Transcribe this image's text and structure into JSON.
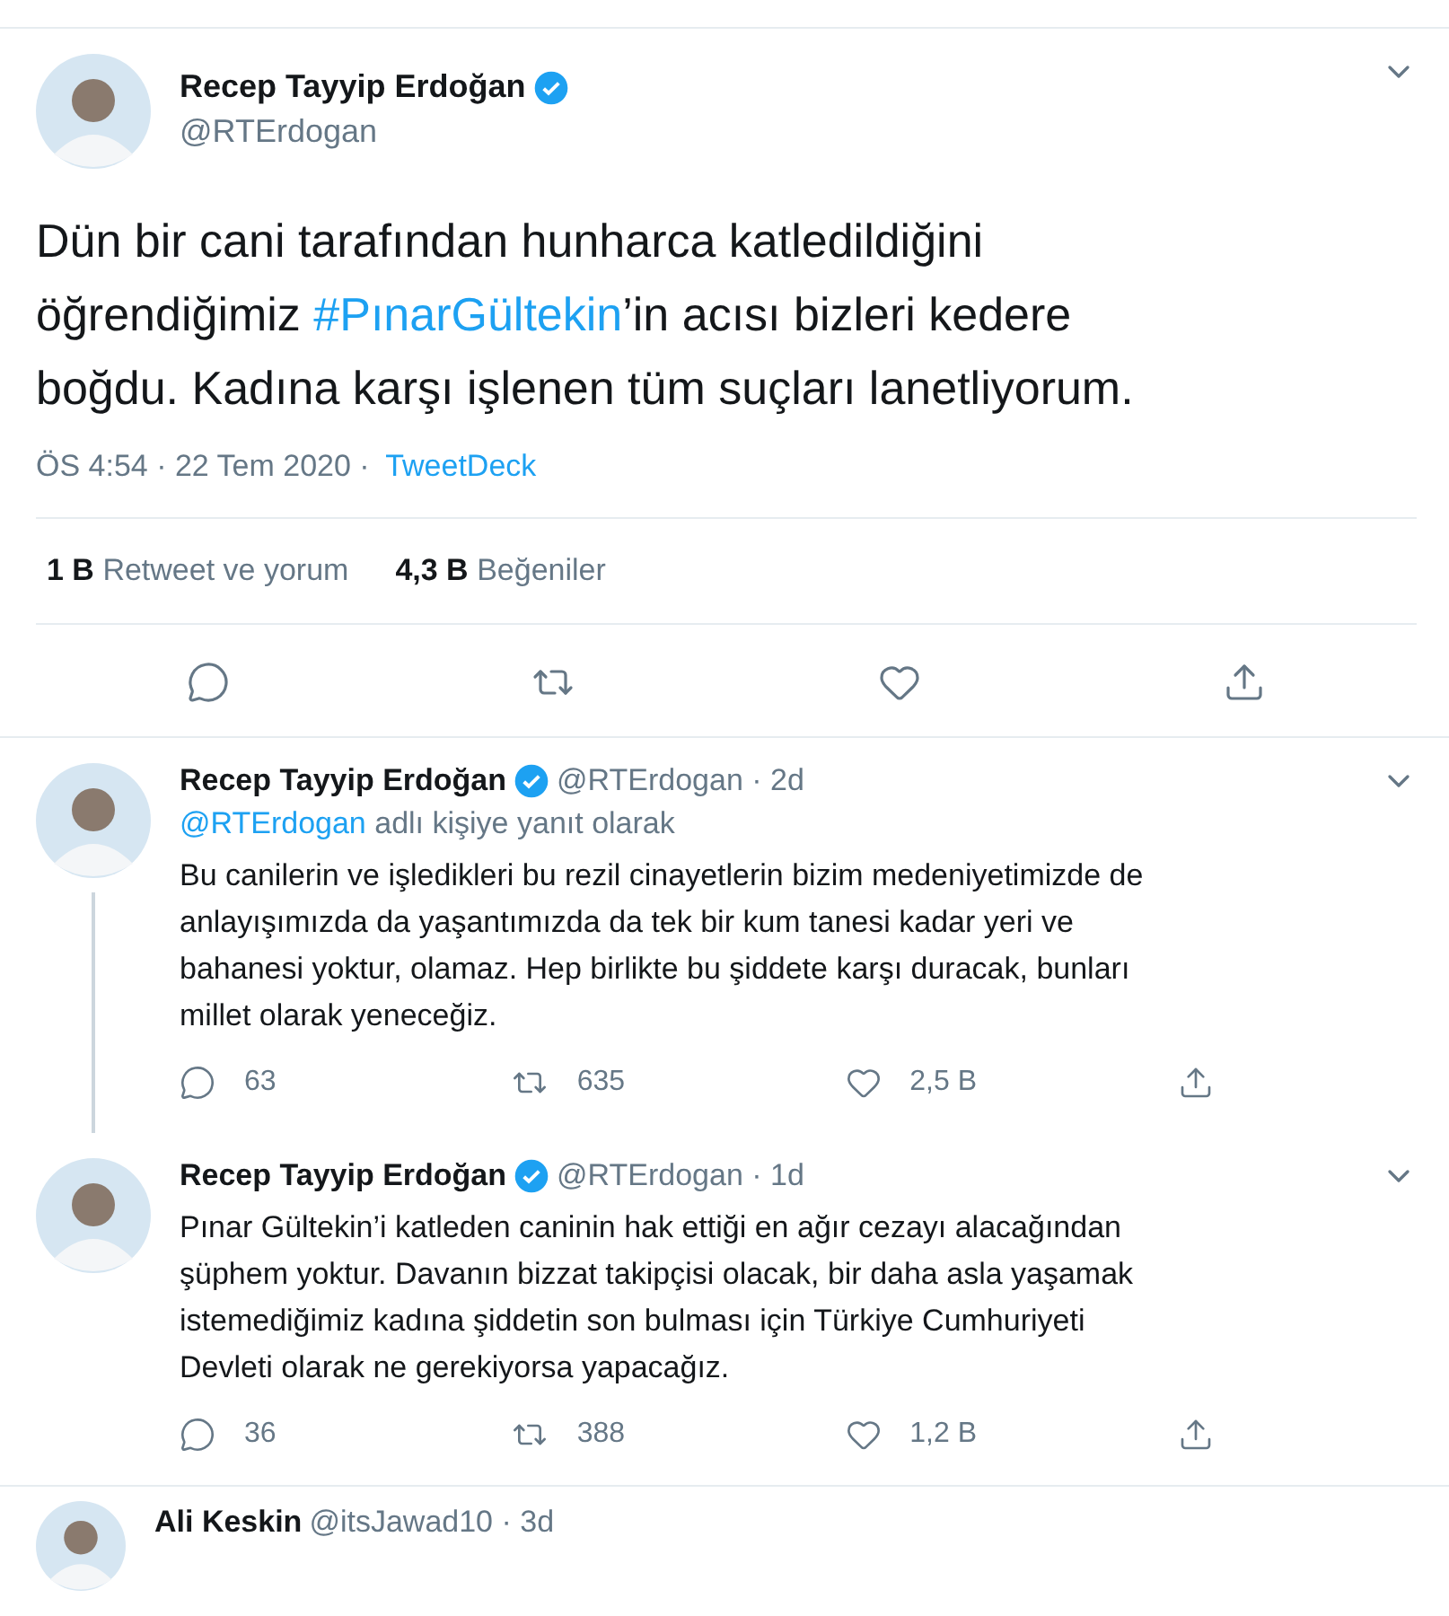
{
  "main_tweet": {
    "author": {
      "name": "Recep Tayyip Erdoğan",
      "handle": "@RTErdogan",
      "verified": true
    },
    "text": [
      {
        "kind": "plain",
        "text": "Dün bir cani tarafından hunharca katledildiğini öğrendiğimiz "
      },
      {
        "kind": "hashtag",
        "text": "#PınarGültekin"
      },
      {
        "kind": "plain",
        "text": "’in acısı bizleri kedere boğdu. Kadına karşı işlenen tüm suçları lanetliyorum."
      }
    ],
    "meta": {
      "time": "ÖS 4:54 · 22 Tem 2020 · ",
      "source": "TweetDeck"
    },
    "stats": [
      {
        "count": "1 B",
        "label": "Retweet ve yorum"
      },
      {
        "count": "4,3 B",
        "label": "Beğeniler"
      }
    ],
    "actions": [
      {
        "kind": "reply"
      },
      {
        "kind": "retweet"
      },
      {
        "kind": "like"
      },
      {
        "kind": "share"
      }
    ]
  },
  "replies": [
    {
      "name": "Recep Tayyip Erdoğan",
      "verified": true,
      "handle_time": "@RTErdogan · 2d",
      "reply_to": {
        "mention": "@RTErdogan",
        "text": "adlı kişiye yanıt olarak"
      },
      "thread_line": true,
      "text": "Bu canilerin ve işledikleri bu rezil cinayetlerin bizim medeniyetimizde de anlayışımızda da yaşantımızda da tek bir kum tanesi kadar yeri ve bahanesi yoktur, olamaz. Hep birlikte bu şiddete karşı duracak, bunları millet olarak yeneceğiz.",
      "actions": [
        {
          "kind": "reply",
          "count": "63"
        },
        {
          "kind": "retweet",
          "count": "635"
        },
        {
          "kind": "like",
          "count": "2,5 B"
        },
        {
          "kind": "share"
        }
      ]
    },
    {
      "name": "Recep Tayyip Erdoğan",
      "verified": true,
      "handle_time": "@RTErdogan · 1d",
      "text": "Pınar Gültekin’i katleden caninin hak ettiği en ağır cezayı alacağından şüphem yoktur. Davanın bizzat takipçisi olacak, bir daha asla yaşamak istemediğimiz kadına şiddetin son bulması için Türkiye Cumhuriyeti Devleti olarak ne gerekiyorsa yapacağız.",
      "actions": [
        {
          "kind": "reply",
          "count": "36"
        },
        {
          "kind": "retweet",
          "count": "388"
        },
        {
          "kind": "like",
          "count": "1,2 B"
        },
        {
          "kind": "share"
        }
      ]
    }
  ],
  "next_tweet": {
    "name": "Ali Keskin",
    "handle_time": "@itsJawad10 · 3d"
  }
}
